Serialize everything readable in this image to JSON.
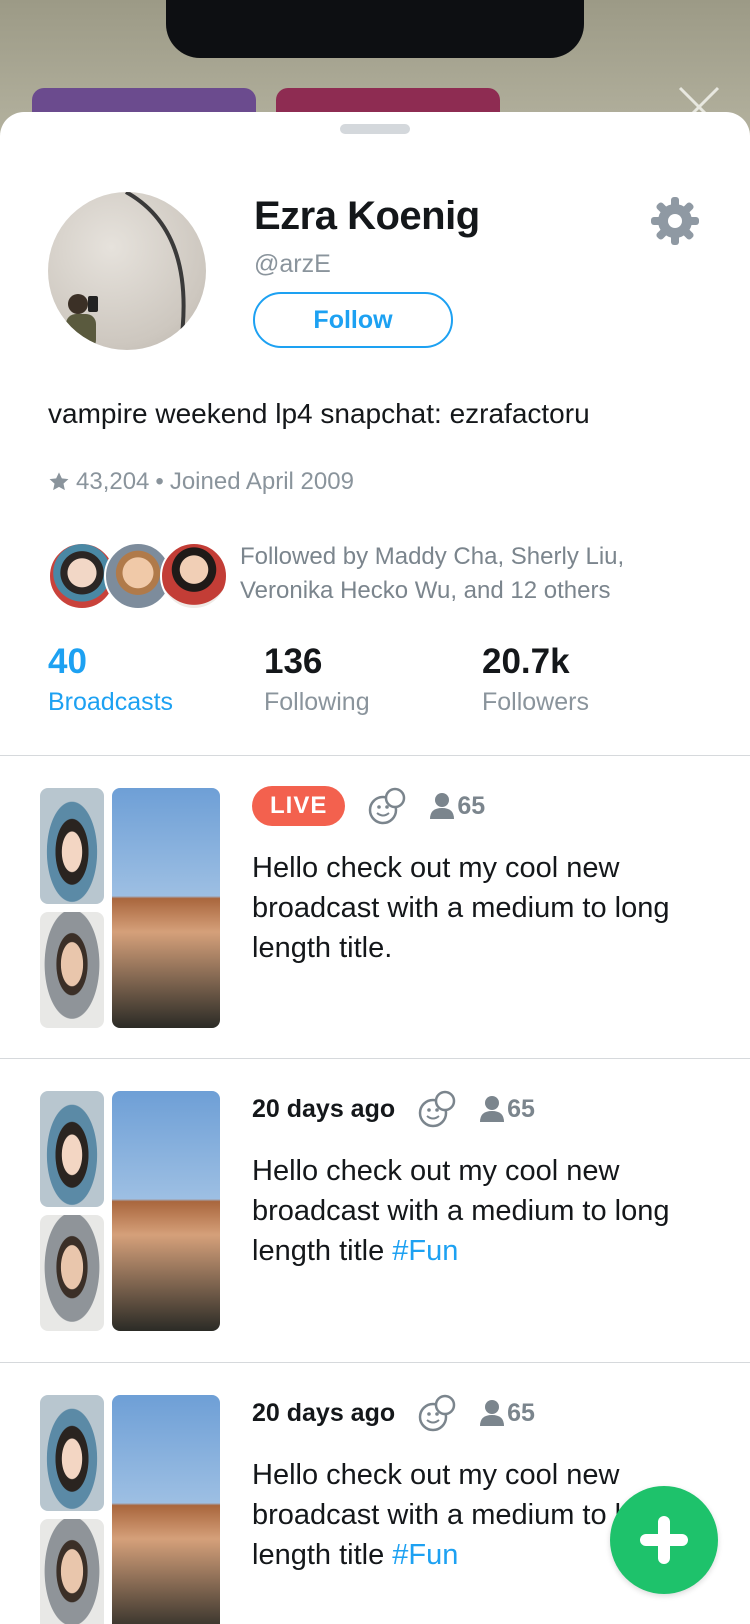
{
  "profile": {
    "name": "Ezra Koenig",
    "handle": "@arzE",
    "follow_label": "Follow",
    "bio": "vampire weekend lp4 snapchat: ezrafactoru",
    "stars": "43,204",
    "joined": "Joined April 2009",
    "followed_by_line1": "Followed by Maddy Cha, Sherly Liu,",
    "followed_by_line2": "Veronika Hecko Wu, and 12 others"
  },
  "stats": [
    {
      "num": "40",
      "label": "Broadcasts"
    },
    {
      "num": "136",
      "label": "Following"
    },
    {
      "num": "20.7k",
      "label": "Followers"
    }
  ],
  "broadcasts": [
    {
      "status": "LIVE",
      "viewers": "65",
      "title": "Hello check out my cool new broadcast with a medium to long length title.",
      "hashtag": ""
    },
    {
      "status": "20 days ago",
      "viewers": "65",
      "title": "Hello check out my cool new broadcast with a medium to long length title",
      "hashtag": "#Fun"
    },
    {
      "status": "20 days ago",
      "viewers": "65",
      "title": "Hello check out my cool new broadcast with a medium to long length title",
      "hashtag": "#Fun"
    }
  ],
  "colors": {
    "accent": "#1da1f2",
    "live": "#f3614e",
    "fab": "#1ec26b"
  },
  "icons": [
    "gear-icon",
    "star-icon",
    "drawing-icon",
    "viewer-icon",
    "plus-icon",
    "close-icon"
  ]
}
